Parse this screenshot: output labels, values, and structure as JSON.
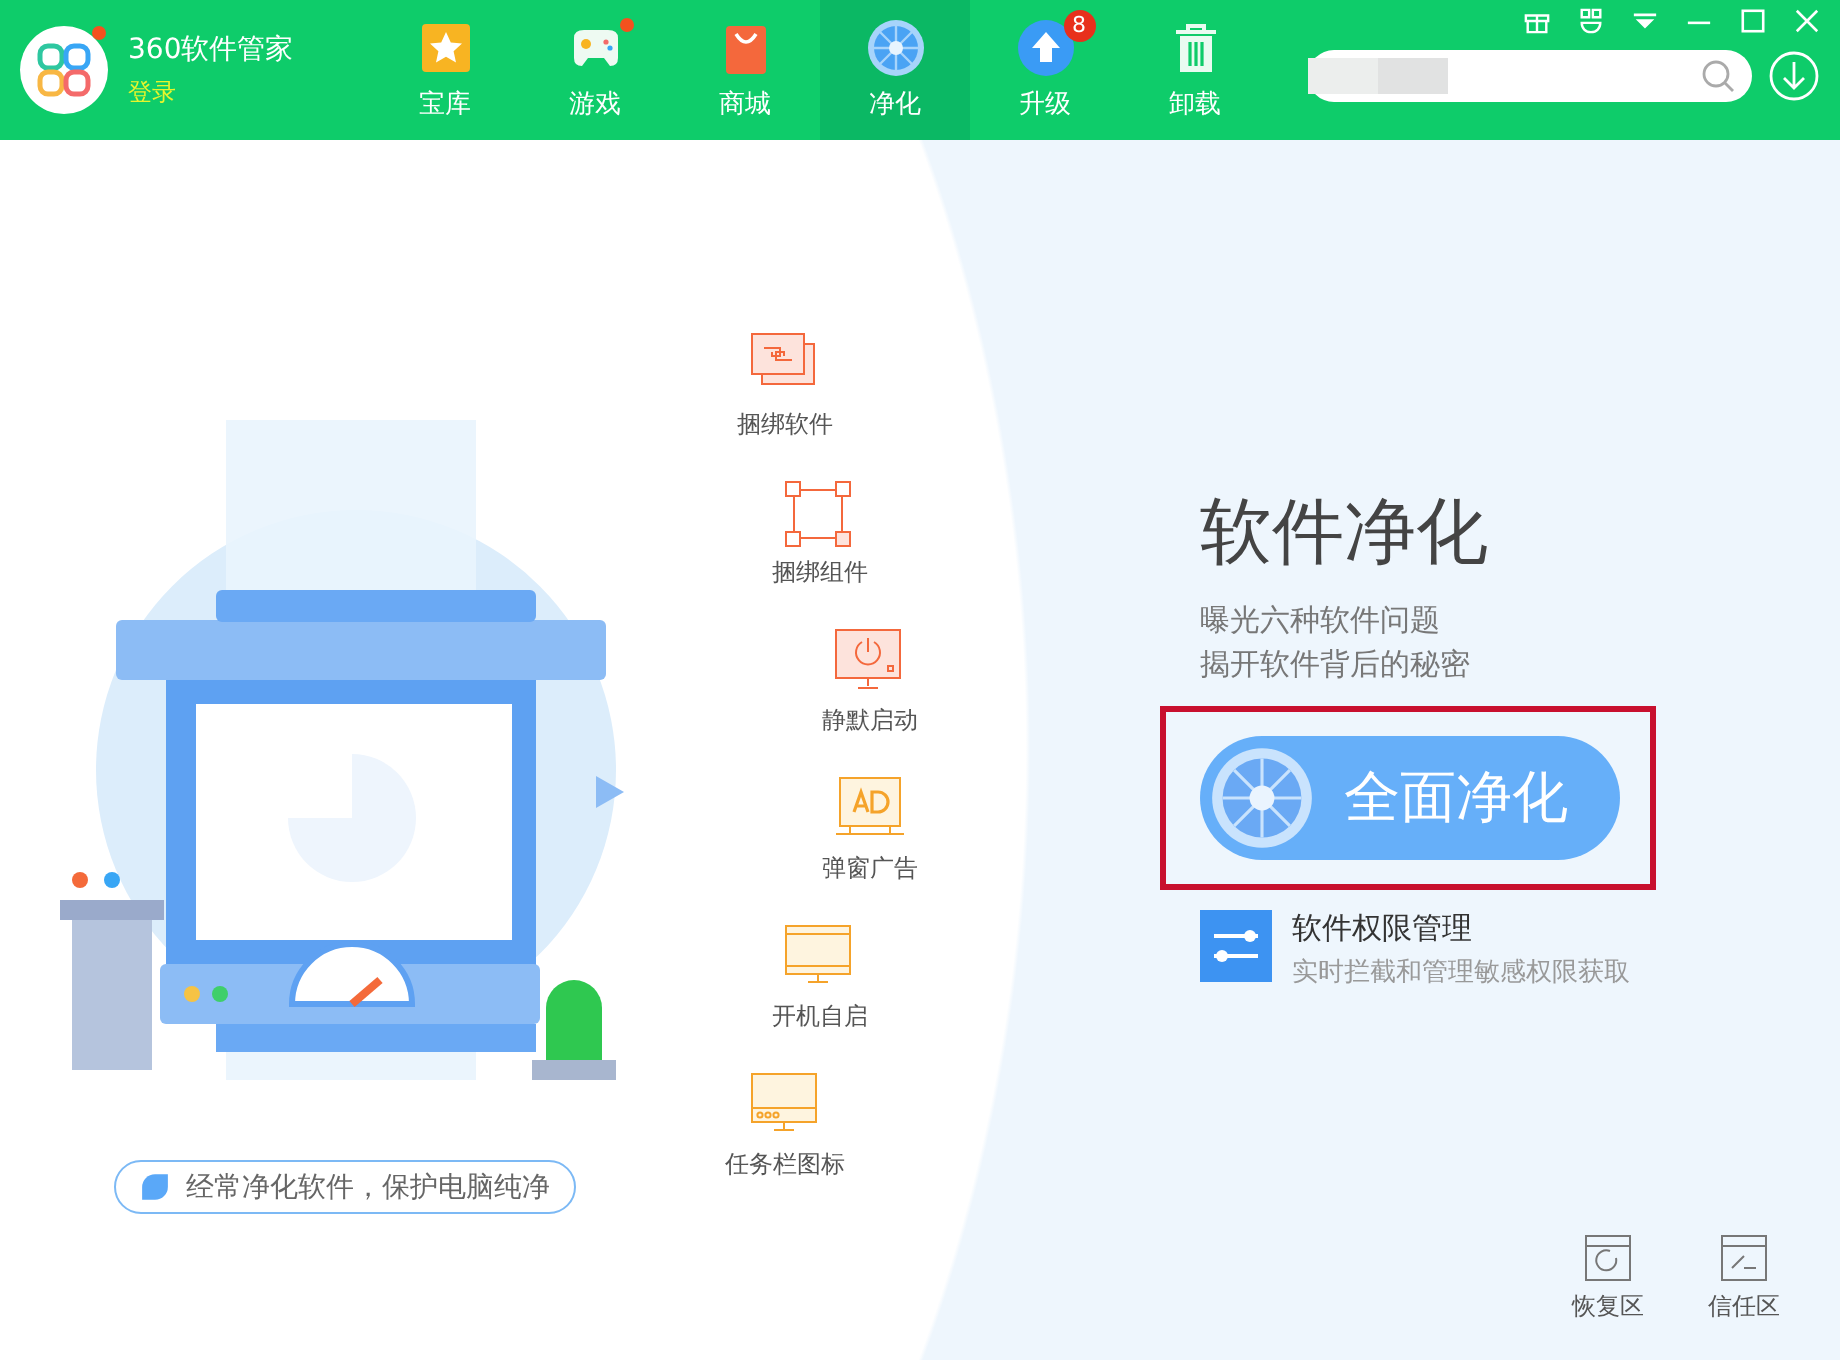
{
  "app": {
    "title": "360软件管家",
    "login": "登录",
    "notice_dot": true
  },
  "nav": [
    {
      "label": "宝库",
      "kind": "star",
      "selected": false,
      "dot": false
    },
    {
      "label": "游戏",
      "kind": "gamepad",
      "selected": false,
      "dot": true
    },
    {
      "label": "商城",
      "kind": "bag",
      "selected": false,
      "dot": false
    },
    {
      "label": "净化",
      "kind": "fan",
      "selected": true,
      "dot": false
    },
    {
      "label": "升级",
      "kind": "upgrade",
      "selected": false,
      "dot": false,
      "badge": "8"
    },
    {
      "label": "卸载",
      "kind": "trash",
      "selected": false,
      "dot": false
    }
  ],
  "features": [
    {
      "label": "捆绑软件",
      "kind": "bundle"
    },
    {
      "label": "捆绑组件",
      "kind": "nodes"
    },
    {
      "label": "静默启动",
      "kind": "power"
    },
    {
      "label": "弹窗广告",
      "kind": "ad"
    },
    {
      "label": "开机自启",
      "kind": "window"
    },
    {
      "label": "任务栏图标",
      "kind": "taskbar"
    }
  ],
  "tagline": "经常净化软件，保护电脑纯净",
  "main": {
    "title": "软件净化",
    "lines": [
      "曝光六种软件问题",
      "揭开软件背后的秘密"
    ],
    "button": "全面净化"
  },
  "permission": {
    "title": "软件权限管理",
    "subtitle": "实时拦截和管理敏感权限获取"
  },
  "bottom": [
    {
      "label": "恢复区",
      "kind": "restore"
    },
    {
      "label": "信任区",
      "kind": "trust"
    }
  ]
}
